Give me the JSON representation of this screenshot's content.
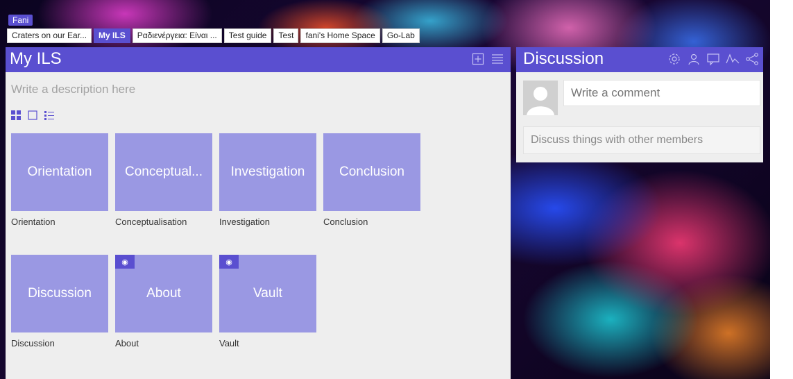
{
  "user": {
    "name": "Fani"
  },
  "tabs": [
    {
      "label": "Craters on our Ear..."
    },
    {
      "label": "My ILS",
      "active": true
    },
    {
      "label": "Ραδιενέργεια: Είναι ..."
    },
    {
      "label": "Test guide"
    },
    {
      "label": "Test"
    },
    {
      "label": "fani's Home Space"
    },
    {
      "label": "Go-Lab"
    }
  ],
  "ils": {
    "title": "My ILS",
    "description_placeholder": "Write a description here",
    "header_icons": [
      "add-icon",
      "menu-icon"
    ],
    "view_icons": [
      "grid-view-icon",
      "single-view-icon",
      "list-view-icon"
    ],
    "phases": [
      {
        "tile": "Orientation",
        "label": "Orientation"
      },
      {
        "tile": "Conceptual...",
        "label": "Conceptualisation"
      },
      {
        "tile": "Investigation",
        "label": "Investigation"
      },
      {
        "tile": "Conclusion",
        "label": "Conclusion"
      },
      {
        "tile": "Discussion",
        "label": "Discussion"
      },
      {
        "tile": "About",
        "label": "About",
        "eye": true
      },
      {
        "tile": "Vault",
        "label": "Vault",
        "eye": true
      }
    ]
  },
  "discussion": {
    "title": "Discussion",
    "header_icons": [
      "settings-icon",
      "members-icon",
      "comments-icon",
      "activity-icon",
      "share-icon"
    ],
    "comment_placeholder": "Write a comment",
    "discuss_text": "Discuss things with other members"
  },
  "colors": {
    "accent": "#5a4fd0",
    "tile": "#9a98e3",
    "panel": "#eeeeee"
  }
}
